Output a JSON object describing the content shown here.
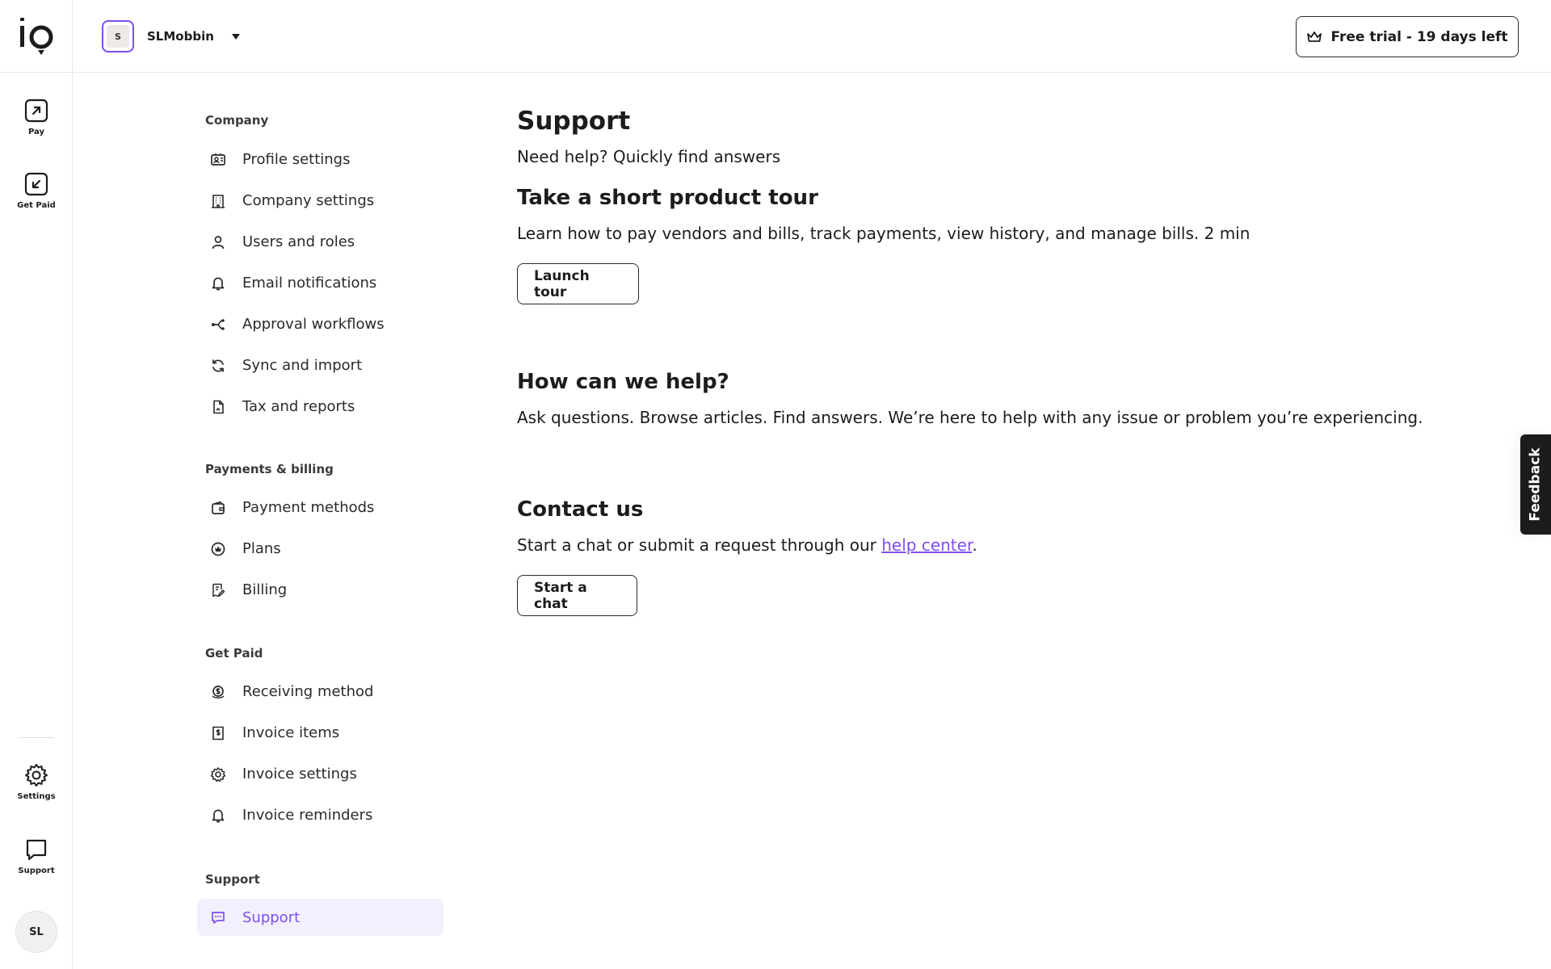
{
  "brand": {
    "logo_text": "io",
    "accent_color": "#7d4ff0"
  },
  "rail": {
    "items": [
      {
        "label": "Pay",
        "icon": "arrow-up-right-icon"
      },
      {
        "label": "Get Paid",
        "icon": "arrow-down-left-icon"
      },
      {
        "label": "Settings",
        "icon": "gear-icon"
      },
      {
        "label": "Support",
        "icon": "chat-bubble-icon"
      }
    ],
    "avatar_initials": "SL"
  },
  "topbar": {
    "org_initial": "S",
    "org_name": "SLMobbin",
    "trial_label": "Free trial - 19 days left"
  },
  "nav": {
    "sections": [
      {
        "title": "Company",
        "items": [
          {
            "label": "Profile settings",
            "icon": "id-card-icon"
          },
          {
            "label": "Company settings",
            "icon": "building-icon"
          },
          {
            "label": "Users and roles",
            "icon": "user-icon"
          },
          {
            "label": "Email notifications",
            "icon": "bell-icon"
          },
          {
            "label": "Approval workflows",
            "icon": "workflow-icon"
          },
          {
            "label": "Sync and import",
            "icon": "sync-icon"
          },
          {
            "label": "Tax and reports",
            "icon": "document-icon"
          }
        ]
      },
      {
        "title": "Payments & billing",
        "items": [
          {
            "label": "Payment methods",
            "icon": "wallet-icon"
          },
          {
            "label": "Plans",
            "icon": "crown-circle-icon"
          },
          {
            "label": "Billing",
            "icon": "receipt-edit-icon"
          }
        ]
      },
      {
        "title": "Get Paid",
        "items": [
          {
            "label": "Receiving method",
            "icon": "coins-icon"
          },
          {
            "label": "Invoice items",
            "icon": "invoice-dollar-icon"
          },
          {
            "label": "Invoice settings",
            "icon": "gear-icon"
          },
          {
            "label": "Invoice reminders",
            "icon": "bell-icon"
          }
        ]
      },
      {
        "title": "Support",
        "items": [
          {
            "label": "Support",
            "icon": "chat-icon",
            "active": true
          }
        ]
      }
    ]
  },
  "main": {
    "title": "Support",
    "subtitle": "Need help? Quickly find answers",
    "tour": {
      "heading": "Take a short product tour",
      "body": "Learn how to pay vendors and bills, track payments, view history, and manage bills. 2 min",
      "button": "Launch tour"
    },
    "help": {
      "heading": "How can we help?",
      "body": "Ask questions. Browse articles. Find answers. We’re here to help with any issue or problem you’re experiencing."
    },
    "contact": {
      "heading": "Contact us",
      "body_prefix": "Start a chat or submit a request through our ",
      "link_text": "help center",
      "body_suffix": ".",
      "button": "Start a chat"
    }
  },
  "feedback_label": "Feedback"
}
